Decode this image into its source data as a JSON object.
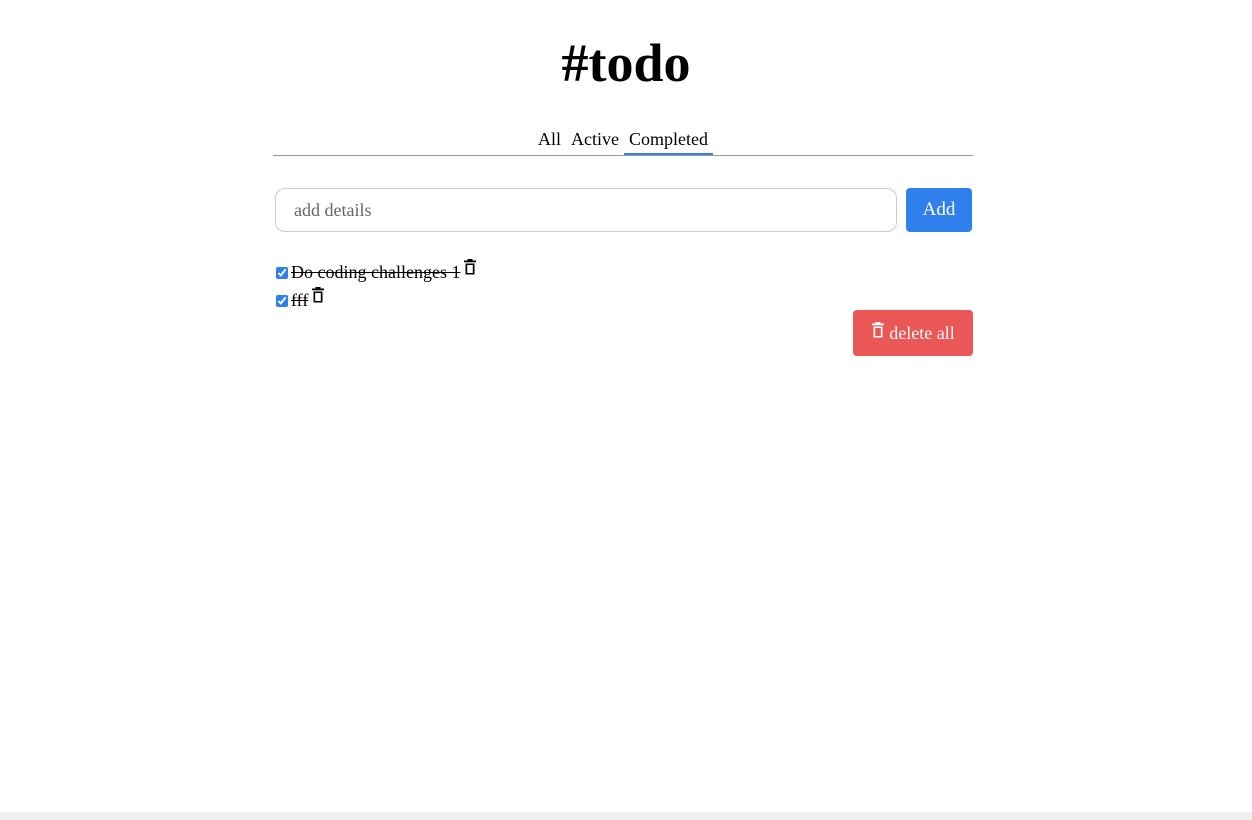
{
  "header": {
    "title": "#todo"
  },
  "tabs": [
    {
      "label": "All",
      "active": false
    },
    {
      "label": "Active",
      "active": false
    },
    {
      "label": "Completed",
      "active": true
    }
  ],
  "add_form": {
    "placeholder": "add details",
    "value": "",
    "add_label": "Add"
  },
  "todos": [
    {
      "text": "Do coding challenges 1",
      "completed": true,
      "icon": "trash-icon"
    },
    {
      "text": "fff",
      "completed": true,
      "icon": "trash-icon"
    }
  ],
  "actions": {
    "delete_all_label": "delete all",
    "delete_all_icon": "trash-icon"
  },
  "colors": {
    "accent": "#2f80ed",
    "danger": "#eb5757",
    "divider": "#999999"
  }
}
